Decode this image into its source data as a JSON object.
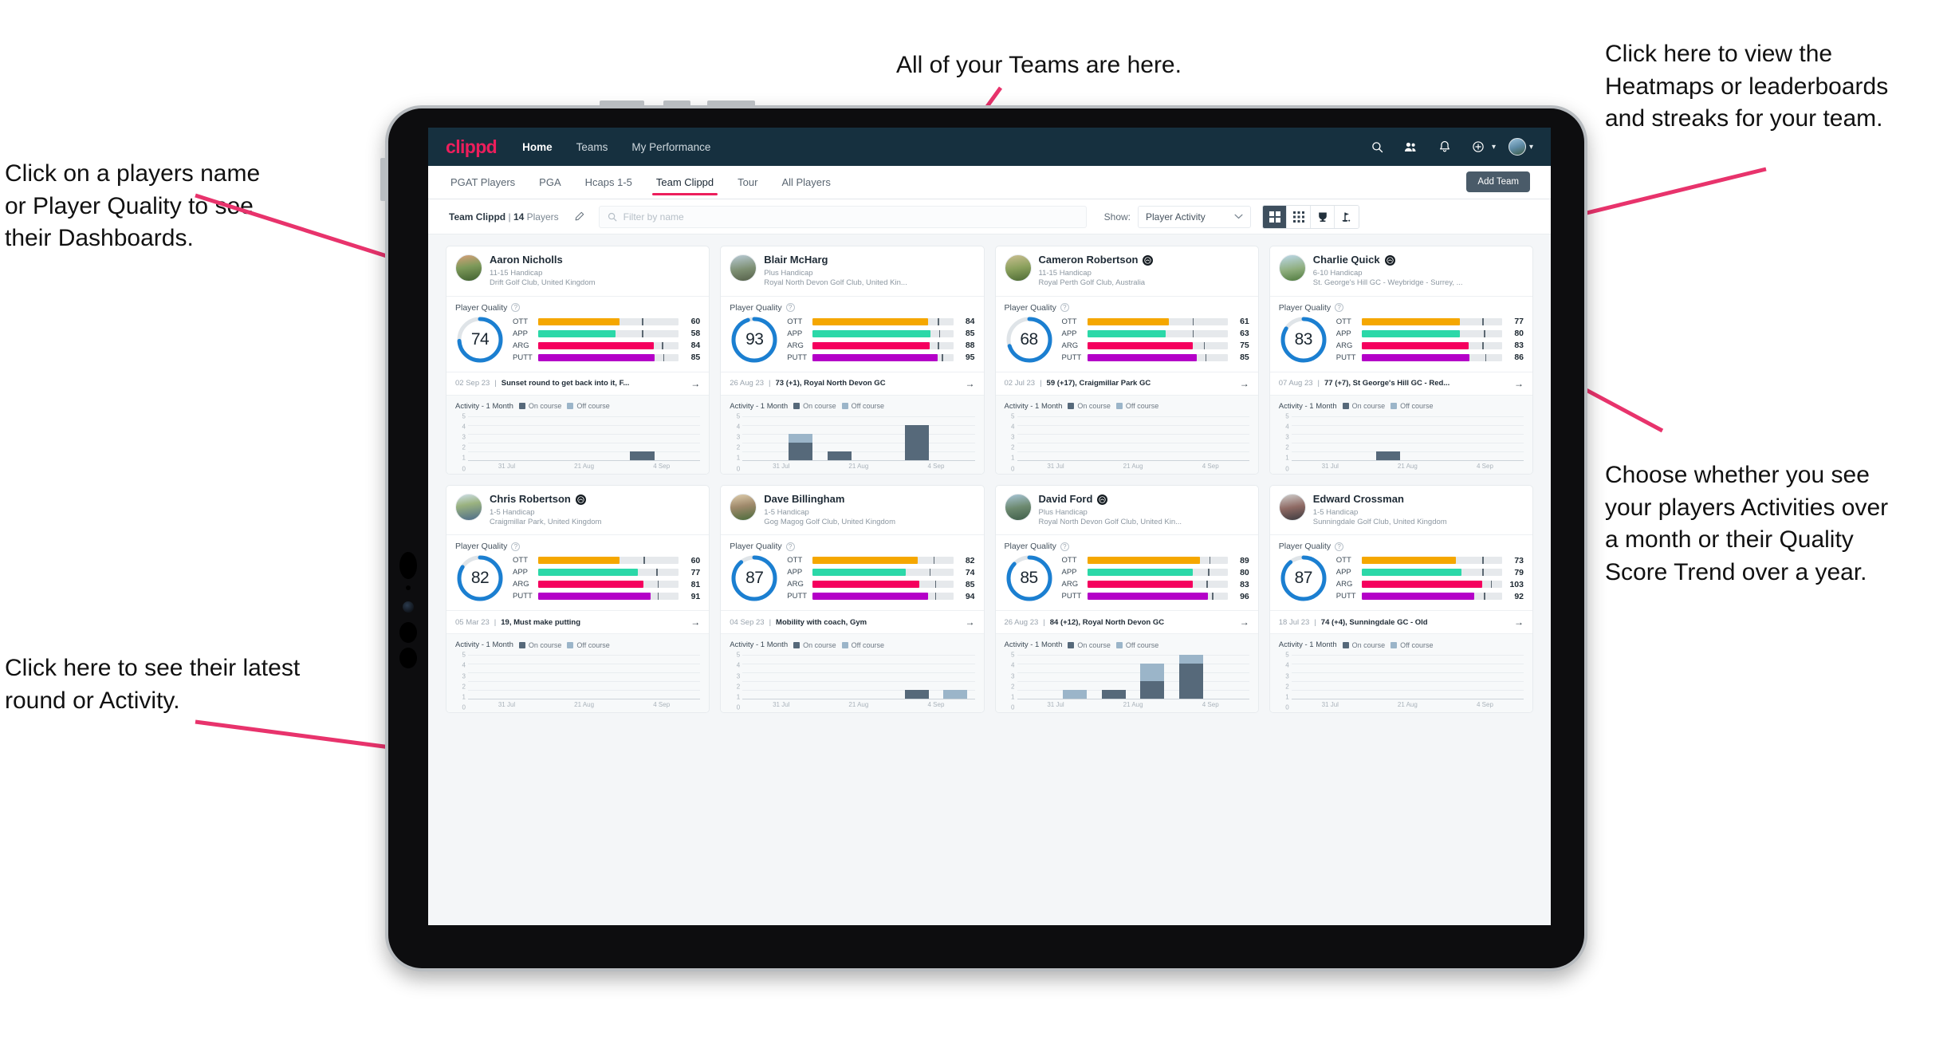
{
  "annotations": {
    "teams": "All of your Teams are here.",
    "heatmaps": "Click here to view the\nHeatmaps or leaderboards\nand streaks for your team.",
    "players": "Click on a players name\nor Player Quality to see\ntheir Dashboards.",
    "choose": "Choose whether you see\nyour players Activities over\na month or their Quality\nScore Trend over a year.",
    "latest": "Click here to see their latest\nround or Activity."
  },
  "colors": {
    "brand": "#ec1e5c",
    "navbar": "#16303f",
    "ring": "#1b7fd1",
    "ott": "#f5a700",
    "app": "#2bd8a8",
    "arg": "#f5005e",
    "putt": "#b400c8",
    "on_course": "#56697a",
    "off_course": "#9bb5c9",
    "arrow": "#e8336c"
  },
  "navbar": {
    "logo": "clippd",
    "links": [
      {
        "label": "Home",
        "active": true
      },
      {
        "label": "Teams",
        "active": false
      },
      {
        "label": "My Performance",
        "active": false
      }
    ],
    "icons": [
      "search-icon",
      "people-icon",
      "bell-icon",
      "plus-circle-icon",
      "avatar"
    ]
  },
  "subtabs": {
    "items": [
      {
        "label": "PGAT Players",
        "active": false
      },
      {
        "label": "PGA",
        "active": false
      },
      {
        "label": "Hcaps 1-5",
        "active": false
      },
      {
        "label": "Team Clippd",
        "active": true
      },
      {
        "label": "Tour",
        "active": false
      },
      {
        "label": "All Players",
        "active": false
      }
    ],
    "add_team_label": "Add Team"
  },
  "toolbar": {
    "team_name": "Team Clippd",
    "separator": "|",
    "player_count": "14",
    "players_word": "Players",
    "edit_icon": "pencil-icon",
    "search_placeholder": "Filter by name",
    "show_label": "Show:",
    "show_value": "Player Activity",
    "views": [
      {
        "name": "grid-large-view",
        "active": true
      },
      {
        "name": "grid-small-view",
        "active": false
      },
      {
        "name": "trophy-leaderboard-view",
        "active": false
      },
      {
        "name": "golf-flag-view",
        "active": false
      }
    ]
  },
  "card_labels": {
    "quality_title": "Player Quality",
    "activity_title": "Activity - 1 Month",
    "legend_on": "On course",
    "legend_off": "Off course",
    "metrics": [
      "OTT",
      "APP",
      "ARG",
      "PUTT"
    ],
    "y_ticks": [
      "5",
      "4",
      "3",
      "2",
      "1",
      "0"
    ],
    "x_ticks": [
      "31 Jul",
      "21 Aug",
      "4 Sep"
    ]
  },
  "chart_data": {
    "type": "bar",
    "title": "Activity - 1 Month (stacked, per player card)",
    "xlabel": "",
    "ylabel": "Rounds / Activities",
    "ylim": [
      0,
      5
    ],
    "grid": true,
    "legend": [
      "On course",
      "Off course"
    ],
    "x_ticks": [
      "31 Jul",
      "21 Aug",
      "4 Sep"
    ],
    "bins": 6,
    "players": [
      {
        "name": "Aaron Nicholls",
        "on_course": [
          0,
          0,
          0,
          0,
          1,
          0
        ],
        "off_course": [
          0,
          0,
          0,
          0,
          0,
          0
        ]
      },
      {
        "name": "Blair McHarg",
        "on_course": [
          0,
          2,
          1,
          0,
          4,
          0
        ],
        "off_course": [
          0,
          1,
          0,
          0,
          0,
          0
        ]
      },
      {
        "name": "Cameron Robertson",
        "on_course": [
          0,
          0,
          0,
          0,
          0,
          0
        ],
        "off_course": [
          0,
          0,
          0,
          0,
          0,
          0
        ]
      },
      {
        "name": "Charlie Quick",
        "on_course": [
          0,
          0,
          1,
          0,
          0,
          0
        ],
        "off_course": [
          0,
          0,
          0,
          0,
          0,
          0
        ]
      },
      {
        "name": "Chris Robertson",
        "on_course": [
          0,
          0,
          0,
          0,
          0,
          0
        ],
        "off_course": [
          0,
          0,
          0,
          0,
          0,
          0
        ]
      },
      {
        "name": "Dave Billingham",
        "on_course": [
          0,
          0,
          0,
          0,
          1,
          0
        ],
        "off_course": [
          0,
          0,
          0,
          0,
          0,
          1
        ]
      },
      {
        "name": "David Ford",
        "on_course": [
          0,
          0,
          1,
          2,
          4,
          0
        ],
        "off_course": [
          0,
          1,
          0,
          2,
          1,
          0
        ]
      },
      {
        "name": "Edward Crossman",
        "on_course": [
          0,
          0,
          0,
          0,
          0,
          0
        ],
        "off_course": [
          0,
          0,
          0,
          0,
          0,
          0
        ]
      }
    ]
  },
  "players": [
    {
      "name": "Aaron Nicholls",
      "verified": false,
      "handicap": "11-15 Handicap",
      "club": "Drift Golf Club, United Kingdom",
      "quality": 74,
      "ring_pct": 74,
      "metrics": [
        {
          "key": "OTT",
          "value": 60,
          "fill_pct": 58,
          "tick_pct": 74
        },
        {
          "key": "APP",
          "value": 58,
          "fill_pct": 55,
          "tick_pct": 74
        },
        {
          "key": "ARG",
          "value": 84,
          "fill_pct": 82,
          "tick_pct": 88
        },
        {
          "key": "PUTT",
          "value": 85,
          "fill_pct": 83,
          "tick_pct": 89
        }
      ],
      "latest_date": "02 Sep 23",
      "latest_text": "Sunset round to get back into it, F..."
    },
    {
      "name": "Blair McHarg",
      "verified": false,
      "handicap": "Plus Handicap",
      "club": "Royal North Devon Golf Club, United Kin...",
      "quality": 93,
      "ring_pct": 95,
      "metrics": [
        {
          "key": "OTT",
          "value": 84,
          "fill_pct": 82,
          "tick_pct": 89
        },
        {
          "key": "APP",
          "value": 85,
          "fill_pct": 84,
          "tick_pct": 90
        },
        {
          "key": "ARG",
          "value": 88,
          "fill_pct": 83,
          "tick_pct": 89
        },
        {
          "key": "PUTT",
          "value": 95,
          "fill_pct": 89,
          "tick_pct": 92
        }
      ],
      "latest_date": "26 Aug 23",
      "latest_text": "73 (+1), Royal North Devon GC"
    },
    {
      "name": "Cameron Robertson",
      "verified": true,
      "handicap": "11-15 Handicap",
      "club": "Royal Perth Golf Club, Australia",
      "quality": 68,
      "ring_pct": 70,
      "metrics": [
        {
          "key": "OTT",
          "value": 61,
          "fill_pct": 58,
          "tick_pct": 75
        },
        {
          "key": "APP",
          "value": 63,
          "fill_pct": 56,
          "tick_pct": 75
        },
        {
          "key": "ARG",
          "value": 75,
          "fill_pct": 75,
          "tick_pct": 83
        },
        {
          "key": "PUTT",
          "value": 85,
          "fill_pct": 78,
          "tick_pct": 84
        }
      ],
      "latest_date": "02 Jul 23",
      "latest_text": "59 (+17), Craigmillar Park GC"
    },
    {
      "name": "Charlie Quick",
      "verified": true,
      "handicap": "6-10 Handicap",
      "club": "St. George's Hill GC - Weybridge - Surrey, ...",
      "quality": 83,
      "ring_pct": 84,
      "metrics": [
        {
          "key": "OTT",
          "value": 77,
          "fill_pct": 70,
          "tick_pct": 86
        },
        {
          "key": "APP",
          "value": 80,
          "fill_pct": 70,
          "tick_pct": 87
        },
        {
          "key": "ARG",
          "value": 83,
          "fill_pct": 76,
          "tick_pct": 86
        },
        {
          "key": "PUTT",
          "value": 86,
          "fill_pct": 77,
          "tick_pct": 88
        }
      ],
      "latest_date": "07 Aug 23",
      "latest_text": "77 (+7), St George's Hill GC - Red..."
    },
    {
      "name": "Chris Robertson",
      "verified": true,
      "handicap": "1-5 Handicap",
      "club": "Craigmillar Park, United Kingdom",
      "quality": 82,
      "ring_pct": 84,
      "metrics": [
        {
          "key": "OTT",
          "value": 60,
          "fill_pct": 58,
          "tick_pct": 75
        },
        {
          "key": "APP",
          "value": 77,
          "fill_pct": 71,
          "tick_pct": 84
        },
        {
          "key": "ARG",
          "value": 81,
          "fill_pct": 75,
          "tick_pct": 85
        },
        {
          "key": "PUTT",
          "value": 91,
          "fill_pct": 80,
          "tick_pct": 85
        }
      ],
      "latest_date": "05 Mar 23",
      "latest_text": "19, Must make putting"
    },
    {
      "name": "Dave Billingham",
      "verified": false,
      "handicap": "1-5 Handicap",
      "club": "Gog Magog Golf Club, United Kingdom",
      "quality": 87,
      "ring_pct": 89,
      "metrics": [
        {
          "key": "OTT",
          "value": 82,
          "fill_pct": 75,
          "tick_pct": 86
        },
        {
          "key": "APP",
          "value": 74,
          "fill_pct": 66,
          "tick_pct": 83
        },
        {
          "key": "ARG",
          "value": 85,
          "fill_pct": 76,
          "tick_pct": 87
        },
        {
          "key": "PUTT",
          "value": 94,
          "fill_pct": 82,
          "tick_pct": 87
        }
      ],
      "latest_date": "04 Sep 23",
      "latest_text": "Mobility with coach, Gym"
    },
    {
      "name": "David Ford",
      "verified": true,
      "handicap": "Plus Handicap",
      "club": "Royal North Devon Golf Club, United Kin...",
      "quality": 85,
      "ring_pct": 87,
      "metrics": [
        {
          "key": "OTT",
          "value": 89,
          "fill_pct": 80,
          "tick_pct": 87
        },
        {
          "key": "APP",
          "value": 80,
          "fill_pct": 75,
          "tick_pct": 86
        },
        {
          "key": "ARG",
          "value": 83,
          "fill_pct": 75,
          "tick_pct": 85
        },
        {
          "key": "PUTT",
          "value": 96,
          "fill_pct": 86,
          "tick_pct": 89
        }
      ],
      "latest_date": "26 Aug 23",
      "latest_text": "84 (+12), Royal North Devon GC"
    },
    {
      "name": "Edward Crossman",
      "verified": false,
      "handicap": "1-5 Handicap",
      "club": "Sunningdale Golf Club, United Kingdom",
      "quality": 87,
      "ring_pct": 89,
      "metrics": [
        {
          "key": "OTT",
          "value": 73,
          "fill_pct": 67,
          "tick_pct": 86
        },
        {
          "key": "APP",
          "value": 79,
          "fill_pct": 71,
          "tick_pct": 86
        },
        {
          "key": "ARG",
          "value": 103,
          "fill_pct": 86,
          "tick_pct": 92
        },
        {
          "key": "PUTT",
          "value": 92,
          "fill_pct": 80,
          "tick_pct": 87
        }
      ],
      "latest_date": "18 Jul 23",
      "latest_text": "74 (+4), Sunningdale GC - Old"
    }
  ]
}
